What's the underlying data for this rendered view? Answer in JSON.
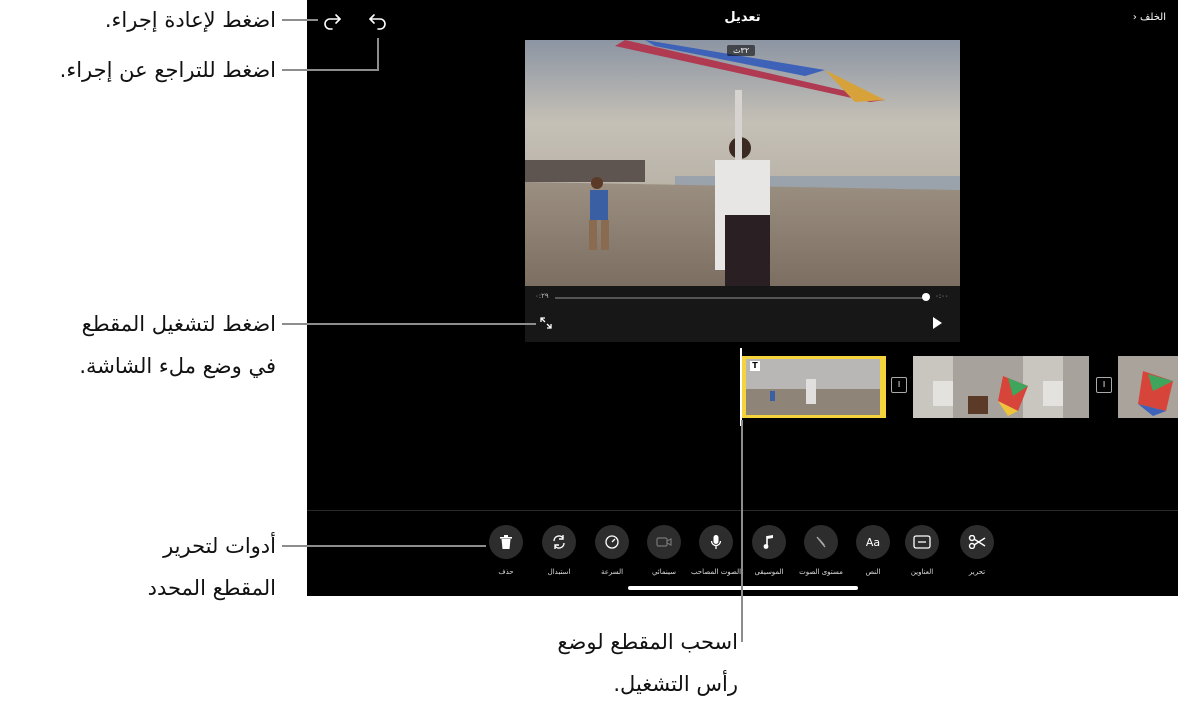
{
  "header": {
    "title": "تعديل",
    "back_label": "الخلف"
  },
  "video": {
    "duration_pill": "٣٢ث",
    "time_left": "٠:٢٩",
    "time_right": "٠:٠٠"
  },
  "timeline": {
    "title_badge": "T",
    "transition_glyph": "I"
  },
  "tools": [
    {
      "label": "تحرير",
      "icon": "scissors-icon"
    },
    {
      "label": "العناوين",
      "icon": "titles-icon"
    },
    {
      "label": "النص",
      "icon": "text-icon",
      "glyph": "Aa"
    },
    {
      "label": "مستوى الصوت",
      "icon": "volume-muted-icon"
    },
    {
      "label": "الموسيقى",
      "icon": "music-note-icon"
    },
    {
      "label": "الصوت المصاحب",
      "icon": "microphone-icon"
    },
    {
      "label": "سينمائي",
      "icon": "cinematic-camera-icon"
    },
    {
      "label": "السرعة",
      "icon": "speed-gauge-icon"
    },
    {
      "label": "استبدال",
      "icon": "replace-icon"
    },
    {
      "label": "حذف",
      "icon": "trash-icon"
    }
  ],
  "callouts": {
    "redo": "اضغط لإعادة إجراء.",
    "undo": "اضغط للتراجع عن إجراء.",
    "fullscreen_line1": "اضغط لتشغيل المقطع",
    "fullscreen_line2": "في وضع ملء الشاشة.",
    "tools_line1": "أدوات لتحرير",
    "tools_line2": "المقطع المحدد",
    "drag_line1": "اسحب المقطع لوضع",
    "drag_line2": "رأس التشغيل."
  },
  "colors": {
    "accent_yellow": "#f5d33c",
    "background": "#000000",
    "tool_circle": "#2d2d2d"
  }
}
